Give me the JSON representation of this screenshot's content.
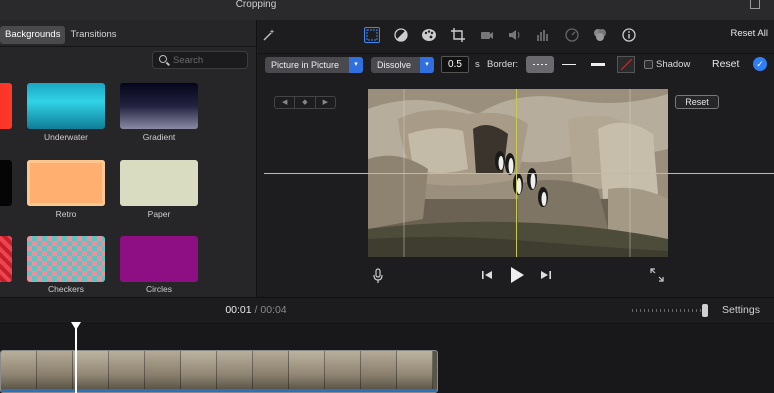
{
  "window": {
    "title": "Cropping"
  },
  "browser": {
    "tabs": [
      {
        "label": "Backgrounds",
        "active": true
      },
      {
        "label": "Transitions",
        "active": false
      }
    ],
    "search_placeholder": "Search",
    "tiles": [
      {
        "label": "Underwater"
      },
      {
        "label": "Gradient"
      },
      {
        "label": "Retro"
      },
      {
        "label": "Paper"
      },
      {
        "label": "Checkers"
      },
      {
        "label": "Circles"
      }
    ]
  },
  "toolbar": {
    "reset_all": "Reset All",
    "tools": [
      "magic-wand-icon",
      "video-overlay-icon",
      "color-balance-icon",
      "color-palette-icon",
      "crop-icon",
      "stabilization-icon",
      "volume-icon",
      "equalizer-icon",
      "speed-icon",
      "filter-icon",
      "info-icon"
    ],
    "active_tool": "video-overlay-icon"
  },
  "overlay": {
    "style": "Picture in Picture",
    "transition": "Dissolve",
    "duration": "0.5",
    "duration_unit": "s",
    "border_label": "Border:",
    "shadow_label": "Shadow",
    "reset_label": "Reset",
    "pip_reset_label": "Reset"
  },
  "timeline": {
    "current_time": "00:01",
    "separator": "/",
    "total_time": "00:04",
    "settings_label": "Settings"
  },
  "colors": {
    "accent": "#3d8bf0",
    "guide": "#c8c84a"
  }
}
